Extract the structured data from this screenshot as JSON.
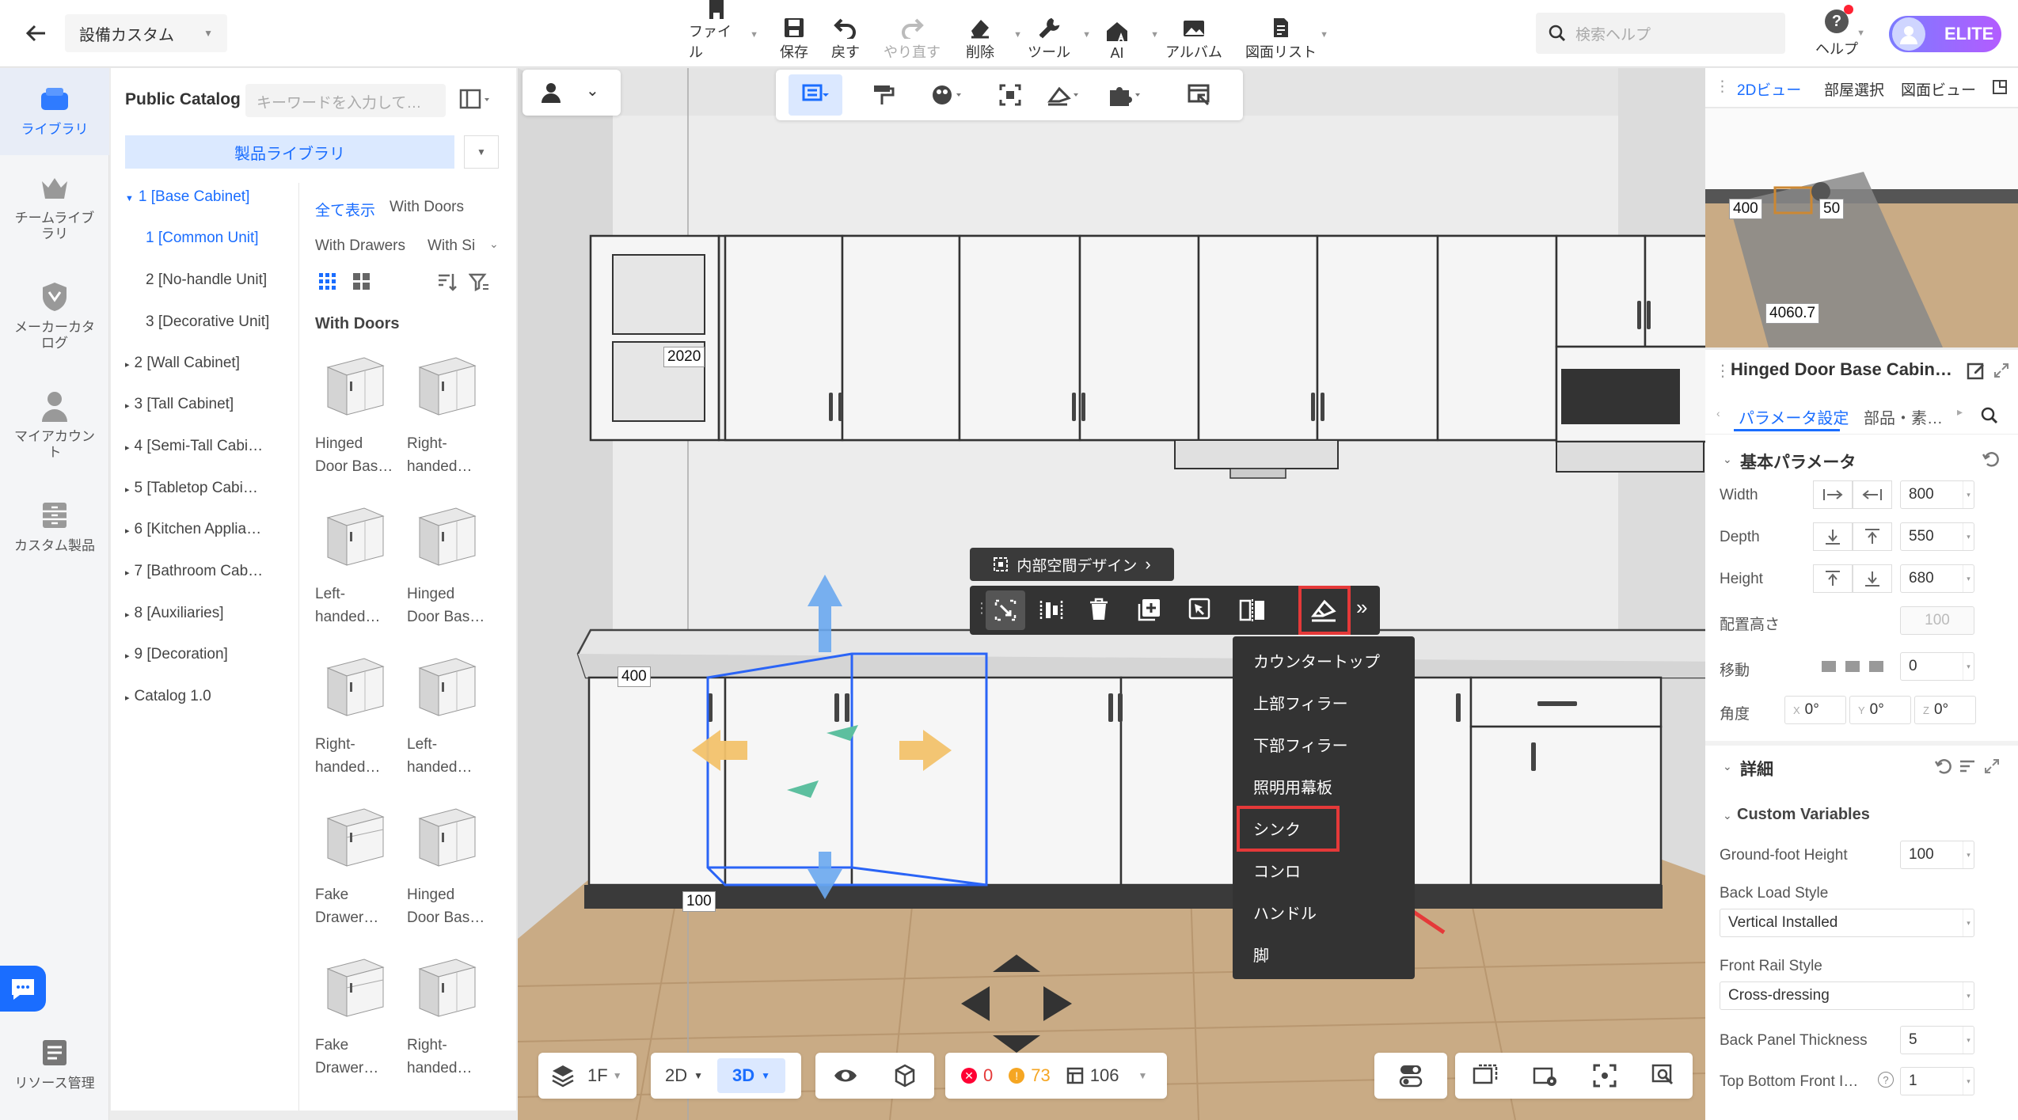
{
  "header": {
    "project_name": "設備カスタム",
    "toolbar": [
      {
        "label": "ファイル",
        "icon": "file-icon"
      },
      {
        "label": "保存",
        "icon": "save-icon"
      },
      {
        "label": "戻す",
        "icon": "undo-icon"
      },
      {
        "label": "やり直す",
        "icon": "redo-icon"
      },
      {
        "label": "削除",
        "icon": "eraser-icon"
      },
      {
        "label": "ツール",
        "icon": "wrench-icon"
      },
      {
        "label": "AI",
        "icon": "ai-house-icon"
      },
      {
        "label": "アルバム",
        "icon": "album-icon"
      },
      {
        "label": "図面リスト",
        "icon": "drawing-list-icon"
      }
    ],
    "search_placeholder": "検索ヘルプ",
    "help_label": "ヘルプ",
    "badge": "ELITE"
  },
  "left_nav": [
    {
      "label": "ライブラリ",
      "active": true
    },
    {
      "label": "チームライブラリ"
    },
    {
      "label": "メーカーカタログ"
    },
    {
      "label": "マイアカウント"
    },
    {
      "label": "カスタム製品"
    },
    {
      "label": "リソース管理"
    }
  ],
  "catalog": {
    "title": "Public Catalog",
    "search_placeholder": "キーワードを入力して…",
    "library_button": "製品ライブラリ",
    "tree": [
      {
        "label": "1 [Base Cabinet]",
        "selected": true
      },
      {
        "label": "1 [Common Unit]",
        "selected": true
      },
      {
        "label": "2 [No-handle Unit]"
      },
      {
        "label": "3 [Decorative Unit]"
      },
      {
        "label": "2 [Wall Cabinet]"
      },
      {
        "label": "3 [Tall Cabinet]"
      },
      {
        "label": "4 [Semi-Tall Cabi…"
      },
      {
        "label": "5 [Tabletop Cabi…"
      },
      {
        "label": "6 [Kitchen Applia…"
      },
      {
        "label": "7 [Bathroom Cab…"
      },
      {
        "label": "8 [Auxiliaries]"
      },
      {
        "label": "9 [Decoration]"
      },
      {
        "label": "Catalog 1.0"
      }
    ],
    "filters": [
      "全て表示",
      "With Doors",
      "With Drawers",
      "With Si"
    ],
    "section_title": "With Doors",
    "products": [
      {
        "line1": "Hinged",
        "line2": "Door Bas…"
      },
      {
        "line1": "Right-",
        "line2": "handed…"
      },
      {
        "line1": "Left-",
        "line2": "handed…"
      },
      {
        "line1": "Hinged",
        "line2": "Door Bas…"
      },
      {
        "line1": "Right-",
        "line2": "handed…"
      },
      {
        "line1": "Left-",
        "line2": "handed…"
      },
      {
        "line1": "Fake",
        "line2": "Drawer…"
      },
      {
        "line1": "Hinged",
        "line2": "Door Bas…"
      },
      {
        "line1": "Fake",
        "line2": "Drawer…"
      },
      {
        "line1": "Right-",
        "line2": "handed…"
      }
    ]
  },
  "viewport": {
    "dimensions": {
      "d1": "2020",
      "d2": "400",
      "d3": "100"
    },
    "inner_design_label": "内部空間デザイン",
    "context_menu": [
      "カウンタートップ",
      "上部フィラー",
      "下部フィラー",
      "照明用幕板",
      "シンク",
      "コンロ",
      "ハンドル",
      "脚"
    ],
    "highlighted_item": "シンク",
    "floor": "1F",
    "view_2d": "2D",
    "view_3d": "3D",
    "errors": "0",
    "warnings": "73",
    "count": "106"
  },
  "right_panel": {
    "tabs": [
      "2Dビュー",
      "部屋選択",
      "図面ビュー"
    ],
    "minimap_labels": {
      "a": "400",
      "b": "50",
      "c": "4060.7"
    },
    "title": "Hinged Door Base Cabin…",
    "subtabs": [
      "パラメータ設定",
      "部品・素…"
    ],
    "section_basic": "基本パラメータ",
    "width_label": "Width",
    "width_value": "800",
    "depth_label": "Depth",
    "depth_value": "550",
    "height_label": "Height",
    "height_value": "680",
    "elev_label": "配置高さ",
    "elev_value": "100",
    "move_label": "移動",
    "move_value": "0",
    "angle_label": "角度",
    "angle_x": "0°",
    "angle_y": "0°",
    "angle_z": "0°",
    "ax_x": "X",
    "ax_y": "Y",
    "ax_z": "Z",
    "section_detail": "詳細",
    "section_custom": "Custom Variables",
    "ground_label": "Ground-foot Height",
    "ground_value": "100",
    "backload_label": "Back Load Style",
    "backload_value": "Vertical Installed",
    "frontrail_label": "Front Rail Style",
    "frontrail_value": "Cross-dressing",
    "backpanel_label": "Back Panel Thickness",
    "backpanel_value": "5",
    "topbottom_label": "Top Bottom Front I…",
    "topbottom_value": "1"
  },
  "colors": {
    "accent": "#1a6dff",
    "highlight": "#e53939"
  }
}
